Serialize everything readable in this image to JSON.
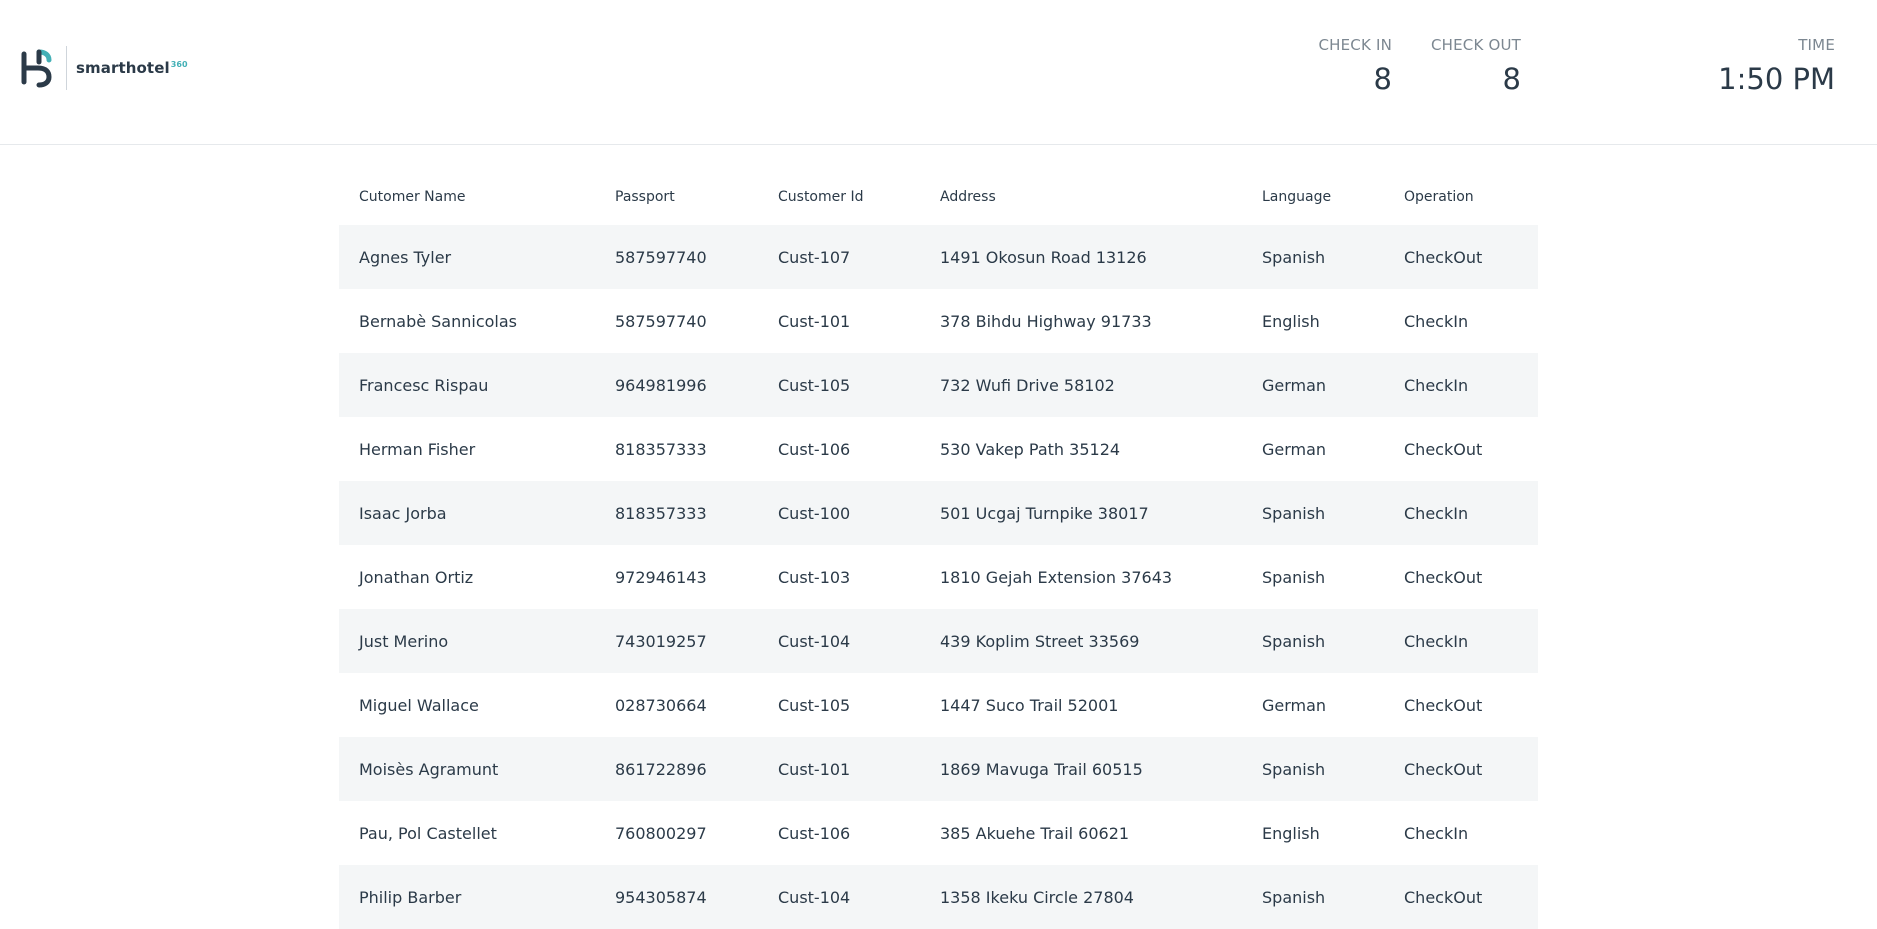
{
  "brand": {
    "name": "smarthotel",
    "superscript": "360"
  },
  "stats": {
    "check_in": {
      "label": "CHECK IN",
      "value": "8"
    },
    "check_out": {
      "label": "CHECK OUT",
      "value": "8"
    },
    "time": {
      "label": "TIME",
      "value": "1:50 PM"
    }
  },
  "table": {
    "headers": [
      "Cutomer Name",
      "Passport",
      "Customer Id",
      "Address",
      "Language",
      "Operation"
    ],
    "rows": [
      [
        "Agnes Tyler",
        "587597740",
        "Cust-107",
        "1491 Okosun Road 13126",
        "Spanish",
        "CheckOut"
      ],
      [
        "Bernabè Sannicolas",
        "587597740",
        "Cust-101",
        "378 Bihdu Highway 91733",
        "English",
        "CheckIn"
      ],
      [
        "Francesc Rispau",
        "964981996",
        "Cust-105",
        "732 Wufi Drive 58102",
        "German",
        "CheckIn"
      ],
      [
        "Herman Fisher",
        "818357333",
        "Cust-106",
        "530 Vakep Path 35124",
        "German",
        "CheckOut"
      ],
      [
        "Isaac Jorba",
        "818357333",
        "Cust-100",
        "501 Ucgaj Turnpike 38017",
        "Spanish",
        "CheckIn"
      ],
      [
        "Jonathan Ortiz",
        "972946143",
        "Cust-103",
        "1810 Gejah Extension 37643",
        "Spanish",
        "CheckOut"
      ],
      [
        "Just Merino",
        "743019257",
        "Cust-104",
        "439 Koplim Street 33569",
        "Spanish",
        "CheckIn"
      ],
      [
        "Miguel Wallace",
        "028730664",
        "Cust-105",
        "1447 Suco Trail 52001",
        "German",
        "CheckOut"
      ],
      [
        "Moisès Agramunt",
        "861722896",
        "Cust-101",
        "1869 Mavuga Trail 60515",
        "Spanish",
        "CheckOut"
      ],
      [
        "Pau, Pol Castellet",
        "760800297",
        "Cust-106",
        "385 Akuehe Trail 60621",
        "English",
        "CheckIn"
      ],
      [
        "Philip Barber",
        "954305874",
        "Cust-104",
        "1358 Ikeku Circle 27804",
        "Spanish",
        "CheckOut"
      ]
    ]
  },
  "colors": {
    "text": "#2b3a48",
    "muted": "#7c8791",
    "row_alt": "#f4f6f7",
    "accent": "#43b0b6"
  },
  "icons": {
    "brand_logo": "smarthotel-logo-icon"
  }
}
